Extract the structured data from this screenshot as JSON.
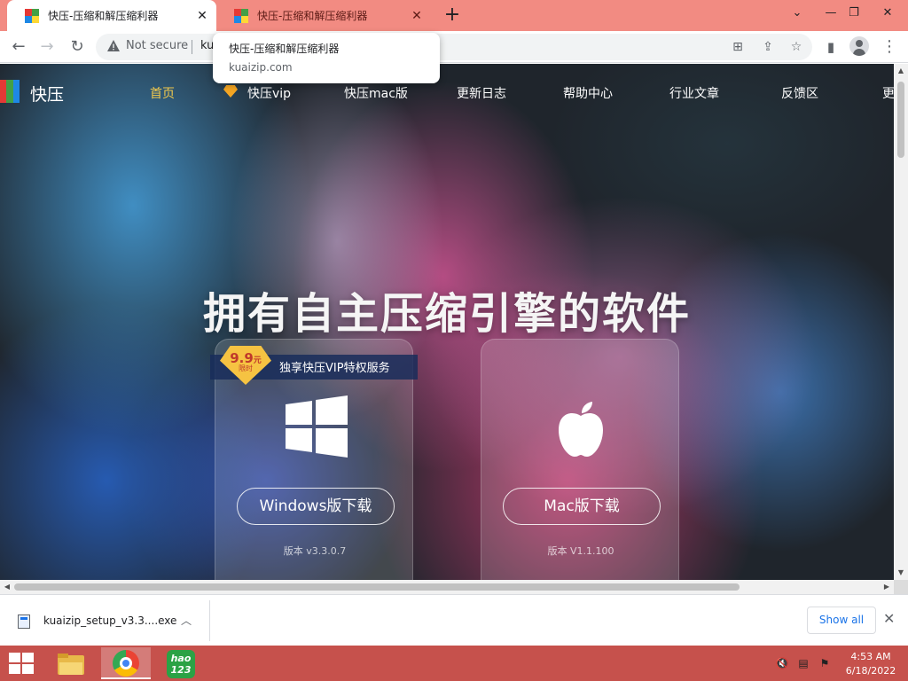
{
  "browser": {
    "tabs": [
      {
        "title": "快压-压缩和解压缩利器",
        "active": true
      },
      {
        "title": "快压-压缩和解压缩利器",
        "active": false
      }
    ],
    "new_tab_label": "+",
    "omnibox": {
      "security_label": "Not secure",
      "url": "kuaizip.com"
    },
    "tooltip": {
      "title": "快压-压缩和解压缩利器",
      "url": "kuaizip.com"
    },
    "colors": {
      "tab_strip": "#f28b82",
      "taskbar": "#c6514c"
    }
  },
  "site": {
    "logo_text": "快压",
    "nav": [
      {
        "label": "首页",
        "current": true
      },
      {
        "label": "快压vip"
      },
      {
        "label": "快压mac版"
      },
      {
        "label": "更新日志"
      },
      {
        "label": "帮助中心"
      },
      {
        "label": "行业文章"
      },
      {
        "label": "反馈区"
      },
      {
        "label": "更"
      }
    ],
    "headline": "拥有自主压缩引擎的软件",
    "vip_promo": {
      "price": "9.9",
      "currency": "元",
      "badge_label": "限时",
      "text": "独享快压VIP特权服务"
    },
    "downloads": {
      "windows": {
        "button_label": "Windows版下载",
        "version": "版本 v3.3.0.7",
        "icon": "windows-icon"
      },
      "mac": {
        "button_label": "Mac版下载",
        "version": "版本 V1.1.100",
        "icon": "apple-icon"
      }
    }
  },
  "download_shelf": {
    "file_name": "kuaizip_setup_v3.3....exe",
    "show_all_label": "Show all"
  },
  "taskbar": {
    "apps": [
      {
        "name": "file-explorer",
        "icon": "folder-icon"
      },
      {
        "name": "chrome",
        "icon": "chrome-icon",
        "active": true
      },
      {
        "name": "hao123",
        "icon": "hao123-icon",
        "label_top": "hao",
        "label_bottom": "123"
      }
    ],
    "clock": {
      "time": "4:53 AM",
      "date": "6/18/2022"
    }
  }
}
